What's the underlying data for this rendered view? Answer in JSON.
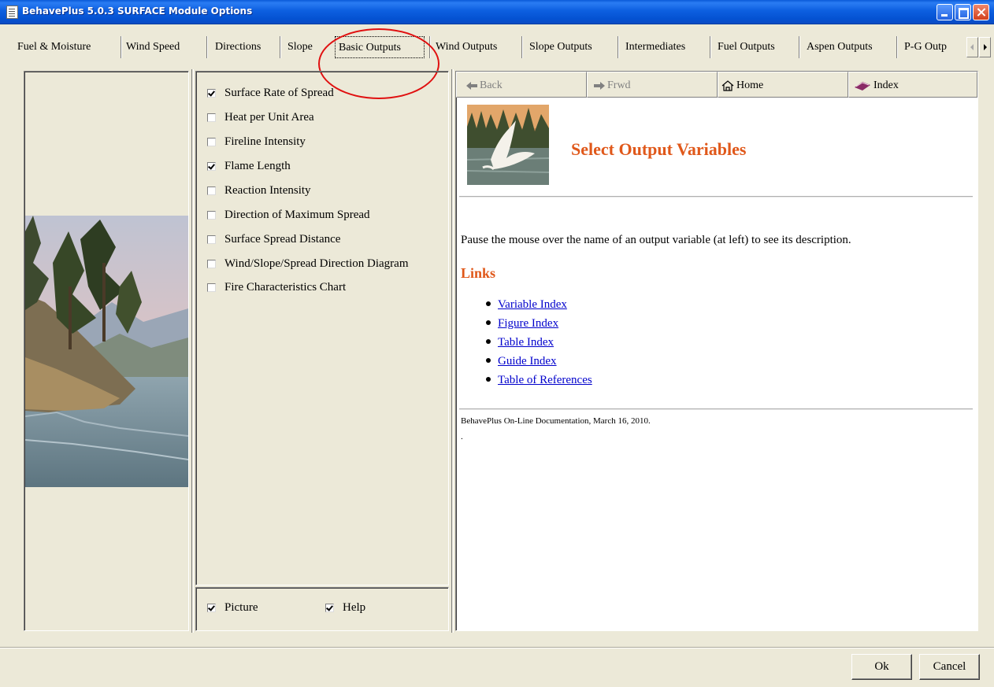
{
  "window": {
    "title": "BehavePlus 5.0.3 SURFACE Module Options",
    "controls": [
      "minimize-icon",
      "maximize-icon",
      "close-icon"
    ]
  },
  "tabs": [
    {
      "label": "Fuel & Moisture",
      "selected": false
    },
    {
      "label": "Wind Speed",
      "selected": false
    },
    {
      "label": "Directions",
      "selected": false
    },
    {
      "label": "Slope",
      "selected": false
    },
    {
      "label": "Basic Outputs",
      "selected": true
    },
    {
      "label": "Wind Outputs",
      "selected": false
    },
    {
      "label": "Slope Outputs",
      "selected": false
    },
    {
      "label": "Intermediates",
      "selected": false
    },
    {
      "label": "Fuel Outputs",
      "selected": false
    },
    {
      "label": "Aspen Outputs",
      "selected": false
    },
    {
      "label": "P-G Outp",
      "selected": false
    }
  ],
  "outputs": [
    {
      "label": "Surface Rate of Spread",
      "checked": true
    },
    {
      "label": "Heat per Unit Area",
      "checked": false
    },
    {
      "label": "Fireline Intensity",
      "checked": false
    },
    {
      "label": "Flame Length",
      "checked": true
    },
    {
      "label": "Reaction Intensity",
      "checked": false
    },
    {
      "label": "Direction of Maximum Spread",
      "checked": false
    },
    {
      "label": "Surface Spread Distance",
      "checked": false
    },
    {
      "label": "Wind/Slope/Spread Direction Diagram",
      "checked": false
    },
    {
      "label": "Fire Characteristics Chart",
      "checked": false
    }
  ],
  "options": {
    "picture": {
      "label": "Picture",
      "checked": true
    },
    "help": {
      "label": "Help",
      "checked": true
    }
  },
  "help": {
    "nav": {
      "back": "Back",
      "frwd": "Frwd",
      "home": "Home",
      "index": "Index"
    },
    "heading": "Select Output Variables",
    "intro": "Pause the mouse over the name of an output variable (at left) to see its description.",
    "links_heading": "Links",
    "links": [
      "Variable Index",
      "Figure Index",
      "Table Index",
      "Guide Index",
      "Table of References"
    ],
    "footer": "BehavePlus On-Line Documentation, March 16, 2010.",
    "trailing": "."
  },
  "buttons": {
    "ok": "Ok",
    "cancel": "Cancel"
  },
  "colors": {
    "title_bar": "#0a5ad8",
    "heading": "#e0581a",
    "link": "#0000cc",
    "annotation": "#e01010",
    "dialog_bg": "#ece9d8"
  }
}
